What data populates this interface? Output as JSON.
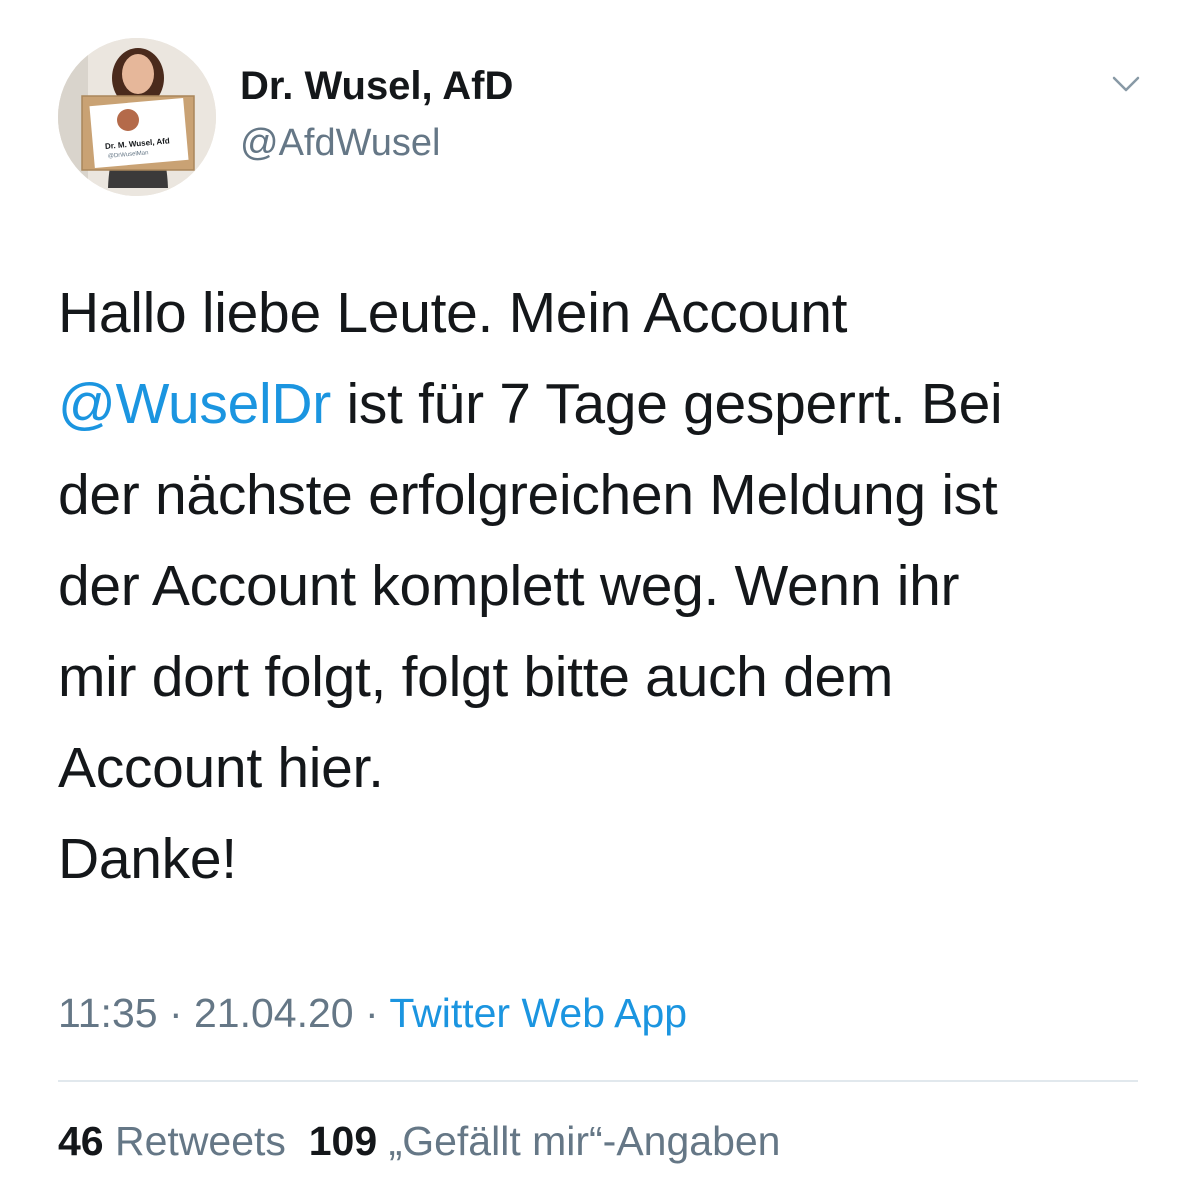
{
  "author": {
    "display_name": "Dr. Wusel, AfD",
    "handle": "@AfdWusel",
    "avatar_sign": {
      "name": "Dr. M. Wusel, Afd",
      "handle": "@DrWuselMan"
    }
  },
  "tweet": {
    "line1": "Hallo liebe Leute. Mein Account",
    "mention": "@WuselDr",
    "line2_rest": " ist für 7 Tage gesperrt. Bei",
    "line3": "der nächste erfolgreichen Meldung ist",
    "line4": "der Account komplett weg. Wenn ihr",
    "line5": "mir dort folgt, folgt bitte auch dem",
    "line6": "Account hier.",
    "line7": "Danke!"
  },
  "meta": {
    "time": "11:35",
    "separator": " · ",
    "date": "21.04.20",
    "source": "Twitter Web App"
  },
  "stats": {
    "retweets_count": "46",
    "retweets_label": "Retweets",
    "likes_count": "109",
    "likes_label": "„Gefällt mir“-Angaben"
  },
  "icons": {
    "menu": "chevron-down-icon"
  },
  "colors": {
    "link": "#1b95e0",
    "secondary": "#657786",
    "text": "#14171a",
    "divider": "#e1e8ed"
  }
}
